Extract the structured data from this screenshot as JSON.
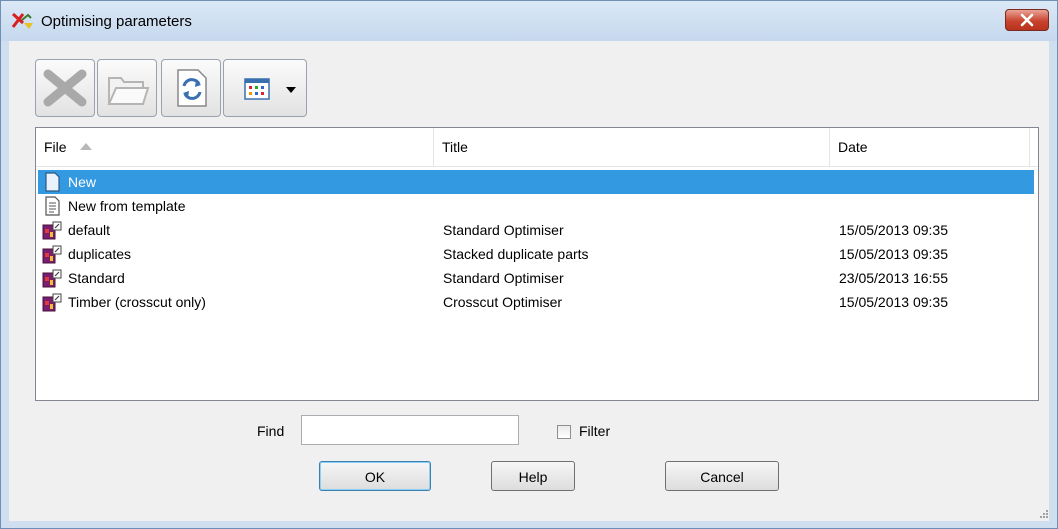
{
  "window": {
    "title": "Optimising parameters"
  },
  "toolbar": {
    "buttons": [
      {
        "icon": "delete-icon",
        "enabled": false
      },
      {
        "icon": "folder-icon",
        "enabled": false
      },
      {
        "icon": "refresh-icon",
        "enabled": true
      },
      {
        "icon": "view-options-icon",
        "enabled": true,
        "has_dropdown": true
      }
    ]
  },
  "list": {
    "columns": [
      "File",
      "Title",
      "Date"
    ],
    "sort": {
      "column": "File",
      "direction": "ascending"
    },
    "rows": [
      {
        "file": "New",
        "title": "",
        "date": "",
        "icon": "new-document-icon",
        "selected": true
      },
      {
        "file": "New from template",
        "title": "",
        "date": "",
        "icon": "template-icon",
        "selected": false
      },
      {
        "file": "default",
        "title": "Standard Optimiser",
        "date": "15/05/2013  09:35",
        "icon": "optimiser-file-icon",
        "selected": false
      },
      {
        "file": "duplicates",
        "title": "Stacked duplicate parts",
        "date": "15/05/2013  09:35",
        "icon": "optimiser-file-icon",
        "selected": false
      },
      {
        "file": "Standard",
        "title": "Standard Optimiser",
        "date": "23/05/2013  16:55",
        "icon": "optimiser-file-icon",
        "selected": false
      },
      {
        "file": "Timber (crosscut only)",
        "title": "Crosscut Optimiser",
        "date": "15/05/2013  09:35",
        "icon": "optimiser-file-icon",
        "selected": false
      }
    ]
  },
  "find": {
    "label": "Find",
    "value": "",
    "placeholder": ""
  },
  "filter": {
    "label": "Filter",
    "checked": false
  },
  "buttons": {
    "ok": "OK",
    "help": "Help",
    "cancel": "Cancel"
  },
  "colors": {
    "selection": "#3399e0",
    "titlebar": "#c5d8ee",
    "close": "#c9442f"
  }
}
